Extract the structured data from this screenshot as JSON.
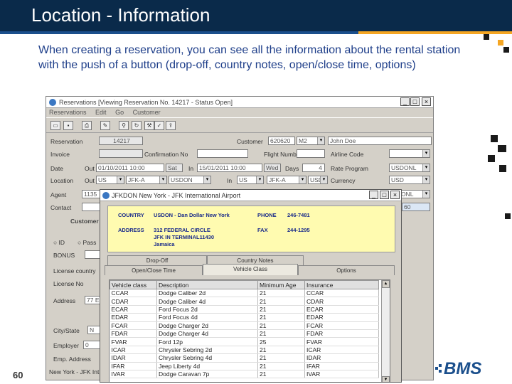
{
  "slide": {
    "title": "Location - Information",
    "intro": "When creating a reservation, you can see all the information about the rental station with the push of a button (drop-off, country notes, open/close time, options)",
    "page_number": "60",
    "logo_text": "BMS",
    "colors": {
      "header": "#0a2a4a",
      "accent": "#f5a623",
      "text": "#1f3f8a"
    }
  },
  "main_window": {
    "title": "Reservations [Viewing Reservation No. 14217 - Status Open]",
    "menu": [
      "Reservations",
      "Edit",
      "Go",
      "Customer"
    ],
    "toolbar_icons": [
      "new-icon",
      "save-icon",
      "print-icon",
      "attach-icon",
      "find-icon",
      "refresh-icon",
      "tools-icon",
      "check-icon",
      "export-icon"
    ],
    "form": {
      "reservation_label": "Reservation",
      "reservation_value": "14217",
      "customer_label": "Customer",
      "customer_code": "620620",
      "customer_type": "M2",
      "customer_name": "John Doe",
      "invoice_label": "Invoice",
      "confirmation_label": "Confirmation No",
      "flight_label": "Flight Number",
      "airline_label": "Airline Code",
      "date_label": "Date",
      "out_label": "Out",
      "out_date": "01/10/2011 10:00",
      "out_day": "Sat",
      "in_label": "In",
      "in_date": "15/01/2011 10:00",
      "in_day": "Wed",
      "days_label": "Days",
      "days_value": "4",
      "rate_program_label": "Rate Program",
      "rate_program_value": "USDONL",
      "location_label": "Location",
      "out_country": "US",
      "out_station": "JFK-A",
      "out_vendor": "USDON",
      "in_country": "US",
      "in_station": "JFK-A",
      "in_vendor": "USDON",
      "currency_label": "Currency",
      "currency_value": "USD",
      "agent_label": "Agent",
      "agent_value": "1135",
      "contact_label": "Contact",
      "customer_section": "Customer",
      "id_option": "ID",
      "passport_option": "Pass",
      "bonus_label": "BONUS",
      "license_label": "License country",
      "license_number_label": "License No",
      "address_label": "Address",
      "address_value": "77 E",
      "city_label": "City/State",
      "city_value": "N",
      "employer_label": "Employer",
      "employer_value": "0",
      "emp_address_label": "Emp. Address",
      "status_text": "New York - JFK Int",
      "side_values": [
        "USDONL",
        "USD",
        "60"
      ]
    }
  },
  "popup": {
    "title": "JFKDON   New York - JFK International Airport",
    "info": {
      "country_label": "COUNTRY",
      "country_value": "USDON - Dan Dollar New York",
      "phone_label": "PHONE",
      "phone_value": "246-7481",
      "address_label": "ADDRESS",
      "address_line1": "312 FEDERAL CIRCLE",
      "address_line2": "JFK IN TERMINAL11430",
      "address_line3": "Jamaica",
      "fax_label": "FAX",
      "fax_value": "244-1295"
    },
    "tabs_row1": [
      "Drop-Off",
      "Country Notes"
    ],
    "tabs_row2": [
      "Open/Close Time",
      "Vehicle Class",
      "Options"
    ],
    "active_tab": "Vehicle Class",
    "columns": [
      "Vehicle class",
      "Description",
      "Minimum Age",
      "Insurance"
    ],
    "rows": [
      [
        "CCAR",
        "Dodge Caliber 2d",
        "21",
        "CCAR"
      ],
      [
        "CDAR",
        "Dodge Caliber 4d",
        "21",
        "CDAR"
      ],
      [
        "ECAR",
        "Ford Focus 2d",
        "21",
        "ECAR"
      ],
      [
        "EDAR",
        "Ford Focus 4d",
        "21",
        "EDAR"
      ],
      [
        "FCAR",
        "Dodge Charger 2d",
        "21",
        "FCAR"
      ],
      [
        "FDAR",
        "Dodge Charger 4d",
        "21",
        "FDAR"
      ],
      [
        "FVAR",
        "Ford 12p",
        "25",
        "FVAR"
      ],
      [
        "ICAR",
        "Chrysler Sebring 2d",
        "21",
        "ICAR"
      ],
      [
        "IDAR",
        "Chrysler Sebring 4d",
        "21",
        "IDAR"
      ],
      [
        "IFAR",
        "Jeep Liberty 4d",
        "21",
        "IFAR"
      ],
      [
        "IVAR",
        "Dodge Caravan 7p",
        "21",
        "IVAR"
      ]
    ]
  }
}
